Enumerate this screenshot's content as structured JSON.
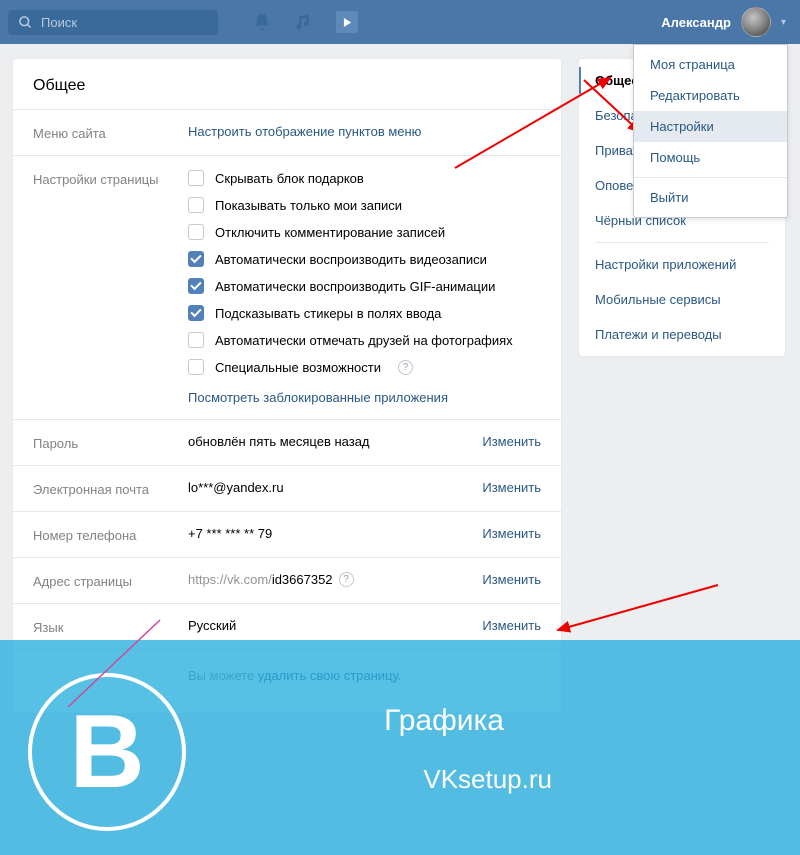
{
  "header": {
    "search_placeholder": "Поиск",
    "user_name": "Александр"
  },
  "dropdown": {
    "items": [
      "Моя страница",
      "Редактировать",
      "Настройки",
      "Помощь"
    ],
    "selected": "Настройки",
    "logout": "Выйти"
  },
  "sidebar": {
    "items": [
      "Общее",
      "Безопасность",
      "Приватность",
      "Оповещения",
      "Чёрный список",
      "Настройки приложений",
      "Мобильные сервисы",
      "Платежи и переводы"
    ],
    "active": "Общее"
  },
  "main": {
    "title": "Общее",
    "menu_label": "Меню сайта",
    "menu_link": "Настроить отображение пунктов меню",
    "page_settings_label": "Настройки страницы",
    "checks": [
      {
        "label": "Скрывать блок подарков",
        "on": false
      },
      {
        "label": "Показывать только мои записи",
        "on": false
      },
      {
        "label": "Отключить комментирование записей",
        "on": false
      },
      {
        "label": "Автоматически воспроизводить видеозаписи",
        "on": true
      },
      {
        "label": "Автоматически воспроизводить GIF-анимации",
        "on": true
      },
      {
        "label": "Подсказывать стикеры в полях ввода",
        "on": true
      },
      {
        "label": "Автоматически отмечать друзей на фотографиях",
        "on": false
      },
      {
        "label": "Специальные возможности",
        "on": false,
        "help": true
      }
    ],
    "blocked_apps": "Посмотреть заблокированные приложения",
    "password_label": "Пароль",
    "password_value": "обновлён пять месяцев назад",
    "email_label": "Электронная почта",
    "email_value": "lo***@yandex.ru",
    "phone_label": "Номер телефона",
    "phone_value": "+7 *** *** ** 79",
    "address_label": "Адрес страницы",
    "address_prefix": "https://vk.com/",
    "address_id": "id3667352",
    "lang_label": "Язык",
    "lang_value": "Русский",
    "change": "Изменить",
    "delete_prefix": "Вы можете ",
    "delete_link": "удалить свою страницу."
  },
  "overlay": {
    "letter": "В",
    "line1": "Графика",
    "line2": "VKsetup.ru"
  }
}
